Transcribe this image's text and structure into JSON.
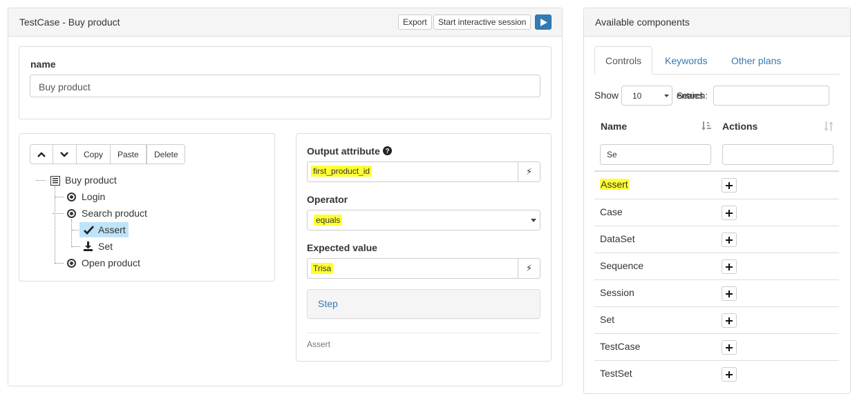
{
  "testcase_panel": {
    "title": "TestCase - Buy product",
    "export_label": "Export",
    "interactive_label": "Start interactive session"
  },
  "name_field": {
    "label": "name",
    "value": "Buy product"
  },
  "tree_toolbar": {
    "copy_label": "Copy",
    "paste_label": "Paste",
    "delete_label": "Delete"
  },
  "tree": {
    "root": "Buy product",
    "login": "Login",
    "search": "Search product",
    "assert": "Assert",
    "set": "Set",
    "open": "Open product"
  },
  "editor": {
    "output_label": "Output attribute",
    "output_value": "first_product_id",
    "operator_label": "Operator",
    "operator_value": "equals",
    "expected_label": "Expected value",
    "expected_value": "Trisa",
    "step_label": "Step",
    "footer_label": "Assert"
  },
  "components_panel": {
    "title": "Available components",
    "tabs": [
      "Controls",
      "Keywords",
      "Other plans"
    ],
    "show_label": "Show",
    "show_value": "10",
    "search_label": "Search:",
    "entries_label": "entries",
    "col_name": "Name",
    "col_actions": "Actions",
    "name_filter": "Se",
    "rows": [
      "Assert",
      "Case",
      "DataSet",
      "Sequence",
      "Session",
      "Set",
      "TestCase",
      "TestSet"
    ]
  },
  "colors": {
    "highlight": "#ffff33",
    "link": "#337ab7",
    "selected": "#bee4f9"
  }
}
